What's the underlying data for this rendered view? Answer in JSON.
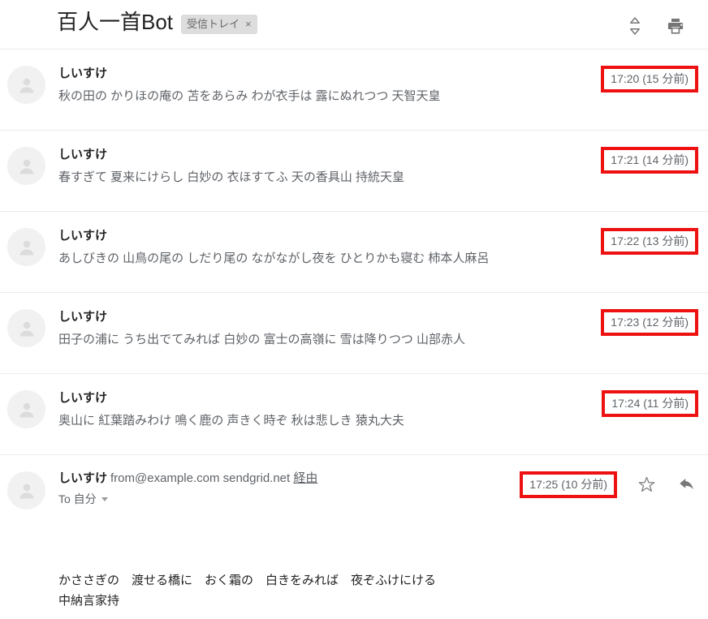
{
  "header": {
    "subject": "百人一首Bot",
    "label": "受信トレイ",
    "label_close": "×",
    "expand_icon": "unfold-more-icon",
    "print_icon": "print-icon"
  },
  "messages": [
    {
      "sender": "しいすけ",
      "snippet": "秋の田の かりほの庵の 苫をあらみ わが衣手は 露にぬれつつ 天智天皇",
      "time": "17:20 (15 分前)"
    },
    {
      "sender": "しいすけ",
      "snippet": "春すぎて 夏来にけらし 白妙の 衣ほすてふ 天の香具山 持統天皇",
      "time": "17:21 (14 分前)"
    },
    {
      "sender": "しいすけ",
      "snippet": "あしびきの 山鳥の尾の しだり尾の ながながし夜を ひとりかも寝む 柿本人麻呂",
      "time": "17:22 (13 分前)"
    },
    {
      "sender": "しいすけ",
      "snippet": "田子の浦に うち出でてみれば 白妙の 富士の高嶺に 雪は降りつつ 山部赤人",
      "time": "17:23 (12 分前)"
    },
    {
      "sender": "しいすけ",
      "snippet": "奥山に 紅葉踏みわけ 鳴く鹿の 声きく時ぞ 秋は悲しき 猿丸大夫",
      "time": "17:24 (11 分前)"
    }
  ],
  "open_message": {
    "sender": "しいすけ",
    "address": "from@example.com",
    "via_domain": "sendgrid.net",
    "via_label": "経由",
    "to_label": "To 自分",
    "time": "17:25 (10 分前)",
    "star_icon": "star-outline-icon",
    "reply_icon": "reply-icon",
    "body": "かささぎの　渡せる橋に　おく霜の　白きをみれば　夜ぞふけにける\n中納言家持"
  },
  "colors": {
    "highlight_box": "#ee1111",
    "divider": "#ebebeb",
    "chip_bg": "#dddddd",
    "secondary_text": "#5f6368",
    "primary_text": "#222222",
    "avatar_bg": "#f1f1f1"
  }
}
